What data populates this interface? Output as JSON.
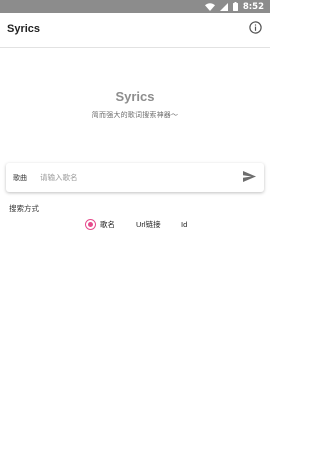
{
  "status_bar": {
    "time": "8:52",
    "icons": [
      "wifi-icon",
      "signal-icon",
      "battery-icon"
    ]
  },
  "app_bar": {
    "title": "Syrics",
    "action_icon": "info-icon"
  },
  "hero": {
    "title": "Syrics",
    "subtitle": "简而强大的歌词搜索神器～"
  },
  "search": {
    "type_label": "歌曲",
    "placeholder": "请输入歌名",
    "value": "",
    "send_icon": "send-icon"
  },
  "search_mode": {
    "label": "搜索方式",
    "options": [
      {
        "label": "歌名",
        "selected": true
      },
      {
        "label": "Url链接",
        "selected": false
      },
      {
        "label": "Id",
        "selected": false
      }
    ]
  },
  "colors": {
    "accent": "#e64b8c",
    "status_bar": "#8c8c8c",
    "hero_title": "#8d8d8d"
  }
}
